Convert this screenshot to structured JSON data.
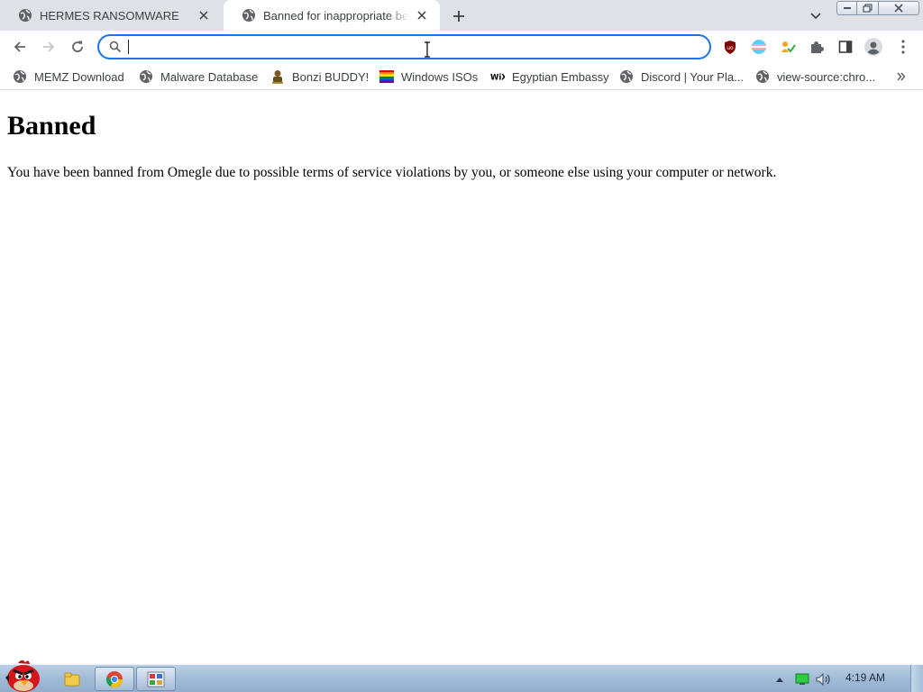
{
  "browser": {
    "tabs": [
      {
        "title": "HERMES RANSOMWARE",
        "active": false
      },
      {
        "title": "Banned for inappropriate behavior",
        "active": true
      }
    ],
    "address_bar": {
      "value": "",
      "placeholder": ""
    },
    "bookmarks": [
      {
        "label": "MEMZ Download",
        "icon": "globe-icon"
      },
      {
        "label": "Malware Database",
        "icon": "globe-icon"
      },
      {
        "label": "Bonzi BUDDY!",
        "icon": "bonzi-icon"
      },
      {
        "label": "Windows ISOs",
        "icon": "rainbow-flag-icon"
      },
      {
        "label": "Egyptian Embassy",
        "icon": "wix-icon"
      },
      {
        "label": "Discord | Your Pla...",
        "icon": "globe-icon"
      },
      {
        "label": "view-source:chro...",
        "icon": "globe-icon"
      }
    ],
    "extensions": [
      "ublock-icon",
      "flag-extension-icon",
      "extension-check-icon",
      "puzzle-icon",
      "side-panel-icon",
      "profile-icon",
      "menu-icon"
    ]
  },
  "page": {
    "heading": "Banned",
    "message": "You have been banned from Omegle due to possible terms of service violations by you, or someone else using your computer or network."
  },
  "taskbar": {
    "clock": "4:19 AM",
    "apps": [
      "angry-bird-start-icon",
      "explorer-icon",
      "chrome-icon",
      "app-icon"
    ]
  },
  "colors": {
    "accent": "#1a73e8",
    "tabstrip": "#dee1e6",
    "taskbar": "#9fb9d6"
  }
}
